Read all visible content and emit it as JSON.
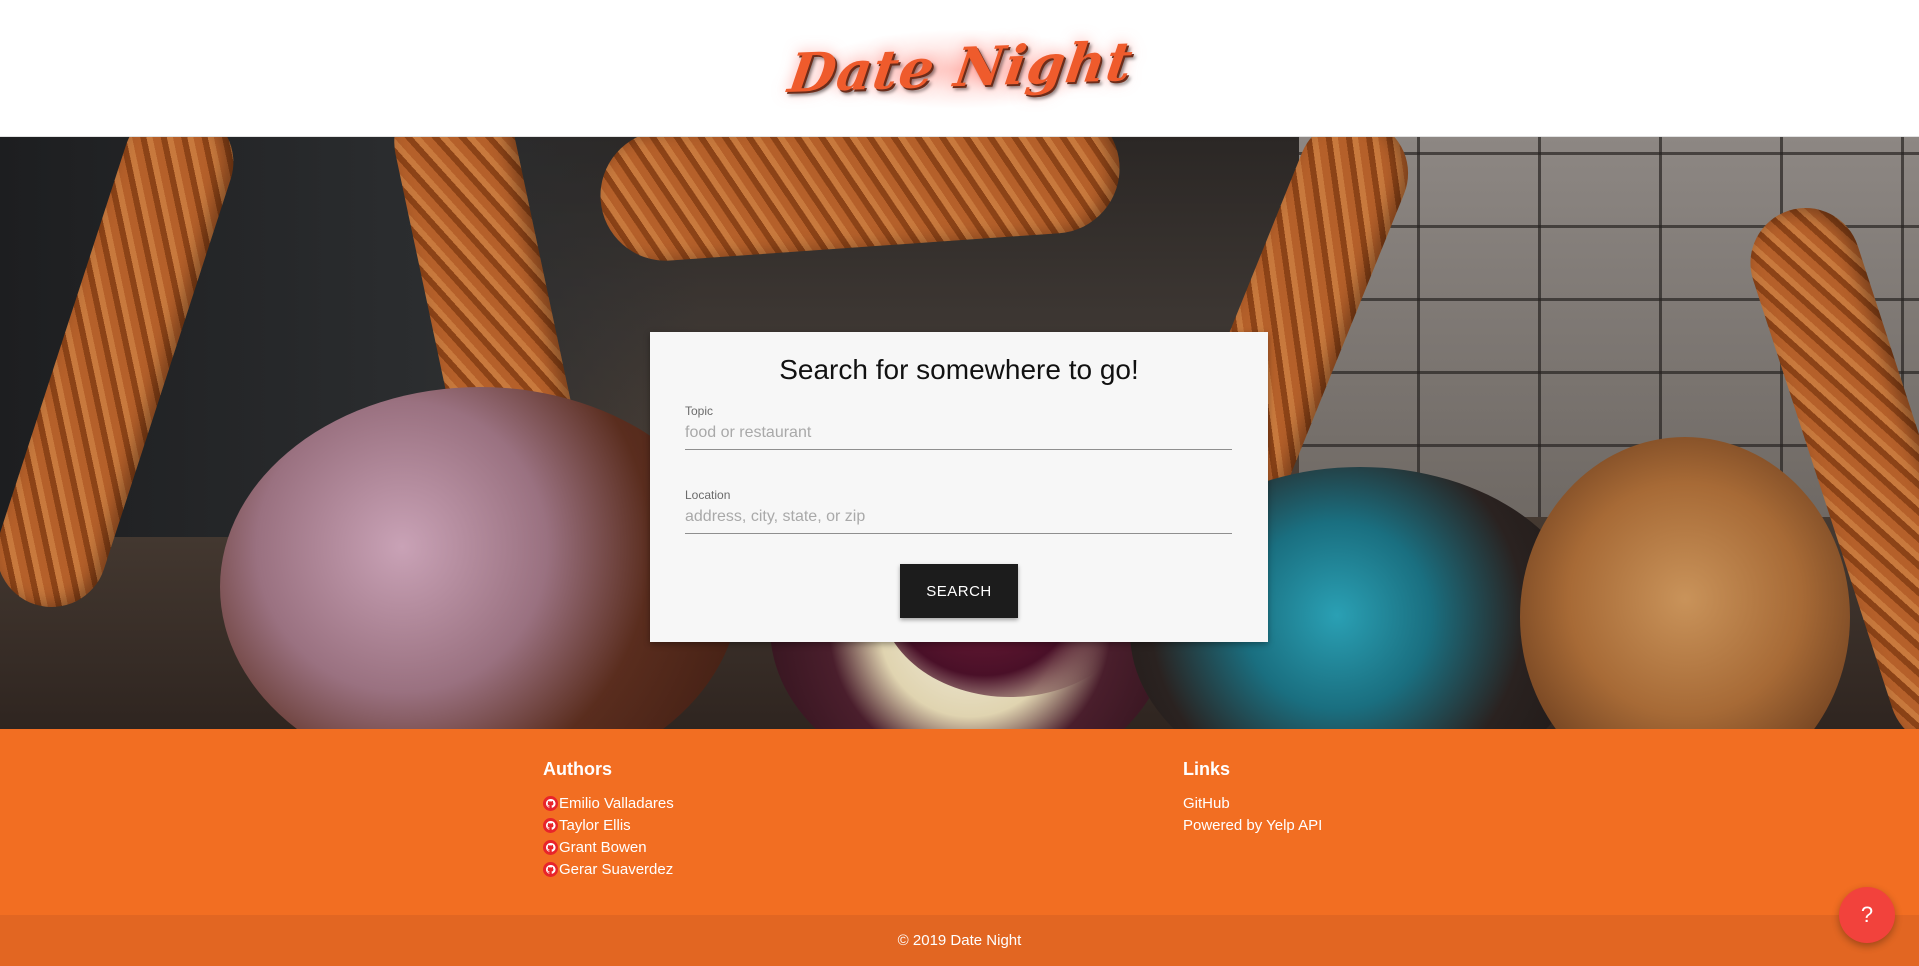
{
  "header": {
    "logo_text": "Date Night"
  },
  "search": {
    "title": "Search for somewhere to go!",
    "topic_label": "Topic",
    "topic_placeholder": "food or restaurant",
    "location_label": "Location",
    "location_placeholder": "address, city, state, or zip",
    "button_label": "SEARCH"
  },
  "footer": {
    "authors_title": "Authors",
    "authors": [
      {
        "name": "Emilio Valladares",
        "icon": "github-icon"
      },
      {
        "name": "Taylor Ellis",
        "icon": "github-icon"
      },
      {
        "name": "Grant Bowen",
        "icon": "github-icon"
      },
      {
        "name": "Gerar Suaverdez",
        "icon": "github-icon"
      }
    ],
    "links_title": "Links",
    "links": [
      {
        "label": "GitHub"
      },
      {
        "label": "Powered by Yelp API"
      }
    ],
    "copyright": "© 2019 Date Night"
  },
  "help": {
    "label": "?"
  },
  "colors": {
    "accent": "#f26e22",
    "footer_bar": "#e26622",
    "logo": "#ef5b2c",
    "help_button": "#f2423c",
    "search_button": "#1c1c1c"
  }
}
